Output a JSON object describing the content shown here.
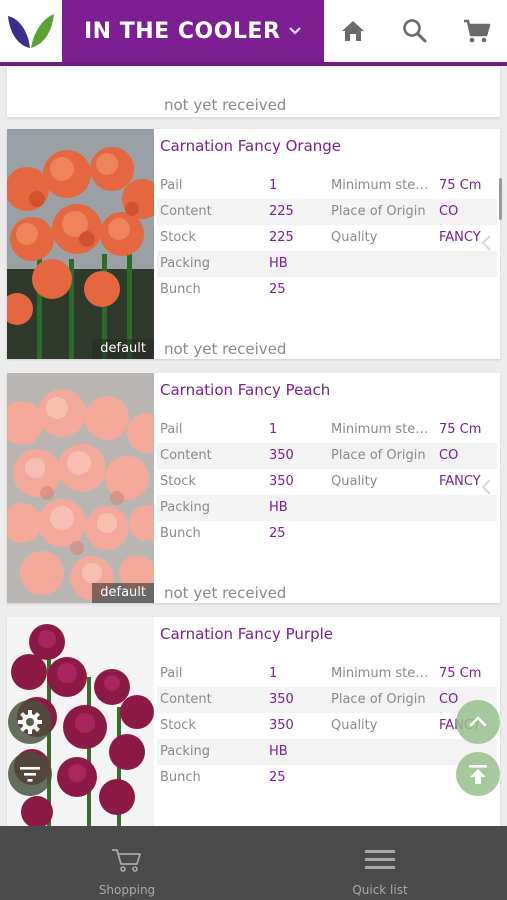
{
  "header": {
    "title": "IN THE COOLER",
    "brand_color": "#7b1f93"
  },
  "partial_card": {
    "status": "not yet received"
  },
  "products": [
    {
      "name": "Carnation Fancy Orange",
      "image_tag": "default",
      "status": "not yet received",
      "attributes": [
        {
          "k1": "Pail",
          "v1": "1",
          "k2": "Minimum stem ...",
          "v2": "75 Cm"
        },
        {
          "k1": "Content",
          "v1": "225",
          "k2": "Place of Origin",
          "v2": "CO"
        },
        {
          "k1": "Stock",
          "v1": "225",
          "k2": "Quality",
          "v2": "FANCY"
        },
        {
          "k1": "Packing",
          "v1": "HB",
          "k2": "",
          "v2": ""
        },
        {
          "k1": "Bunch",
          "v1": "25",
          "k2": "",
          "v2": ""
        }
      ]
    },
    {
      "name": "Carnation Fancy Peach",
      "image_tag": "default",
      "status": "not yet received",
      "attributes": [
        {
          "k1": "Pail",
          "v1": "1",
          "k2": "Minimum stem ...",
          "v2": "75 Cm"
        },
        {
          "k1": "Content",
          "v1": "350",
          "k2": "Place of Origin",
          "v2": "CO"
        },
        {
          "k1": "Stock",
          "v1": "350",
          "k2": "Quality",
          "v2": "FANCY"
        },
        {
          "k1": "Packing",
          "v1": "HB",
          "k2": "",
          "v2": ""
        },
        {
          "k1": "Bunch",
          "v1": "25",
          "k2": "",
          "v2": ""
        }
      ]
    },
    {
      "name": "Carnation Fancy Purple",
      "image_tag": "",
      "status": "",
      "attributes": [
        {
          "k1": "Pail",
          "v1": "1",
          "k2": "Minimum stem ...",
          "v2": "75 Cm"
        },
        {
          "k1": "Content",
          "v1": "350",
          "k2": "Place of Origin",
          "v2": "CO"
        },
        {
          "k1": "Stock",
          "v1": "350",
          "k2": "Quality",
          "v2": "FANCY"
        },
        {
          "k1": "Packing",
          "v1": "HB",
          "k2": "",
          "v2": ""
        },
        {
          "k1": "Bunch",
          "v1": "25",
          "k2": "",
          "v2": ""
        }
      ]
    }
  ],
  "icons": {
    "logo": "leaf-logo-icon",
    "home": "home-icon",
    "search": "search-icon",
    "cart": "cart-icon",
    "settings": "gear-icon",
    "filter": "filter-icon",
    "up": "chevron-up-icon",
    "top": "scroll-top-icon"
  },
  "bottom_nav": {
    "shopping": "Shopping",
    "quick_list": "Quick list"
  }
}
